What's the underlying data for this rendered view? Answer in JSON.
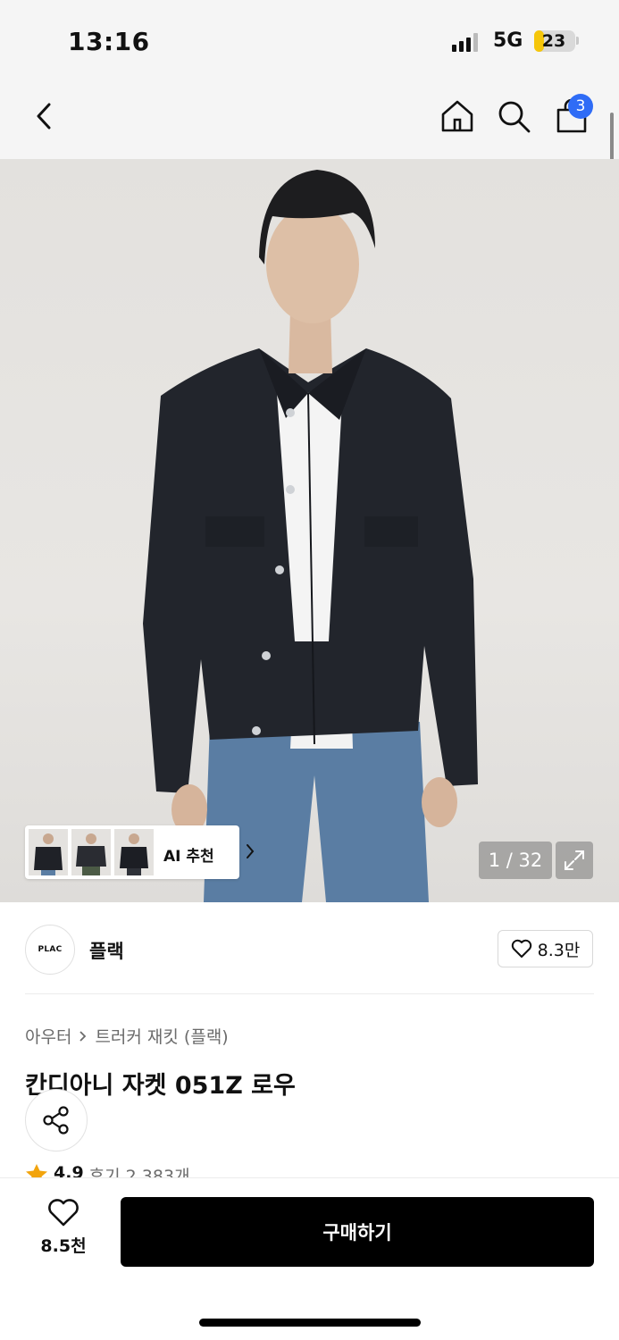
{
  "status_bar": {
    "time": "13:16",
    "network": "5G",
    "battery_level": "23",
    "battery_fraction": 0.23
  },
  "header": {
    "back_icon": "chevron-left-icon",
    "home_icon": "home-icon",
    "search_icon": "search-icon",
    "cart_icon": "shopping-bag-icon",
    "cart_count": "3"
  },
  "gallery": {
    "image_index": "1 / 32",
    "ai_recommend_label": "AI 추천",
    "thumbnail_count": 3,
    "expand_icon": "expand-icon"
  },
  "brand": {
    "logo_text": "PLAC",
    "name": "플랙",
    "likes": "8.3만"
  },
  "product": {
    "breadcrumbs": [
      "아우터",
      "트러커 재킷 (플랙)"
    ],
    "title": "칸디아니 자켓 051Z 로우",
    "rating": "4.9",
    "reviews": "후기 2,383개"
  },
  "bottom_bar": {
    "wish_count": "8.5천",
    "buy_label": "구매하기"
  },
  "colors": {
    "accent_badge": "#2f6cf6",
    "buy_button": "#000000",
    "star": "#f2a40c",
    "battery": "#f5c60a"
  }
}
